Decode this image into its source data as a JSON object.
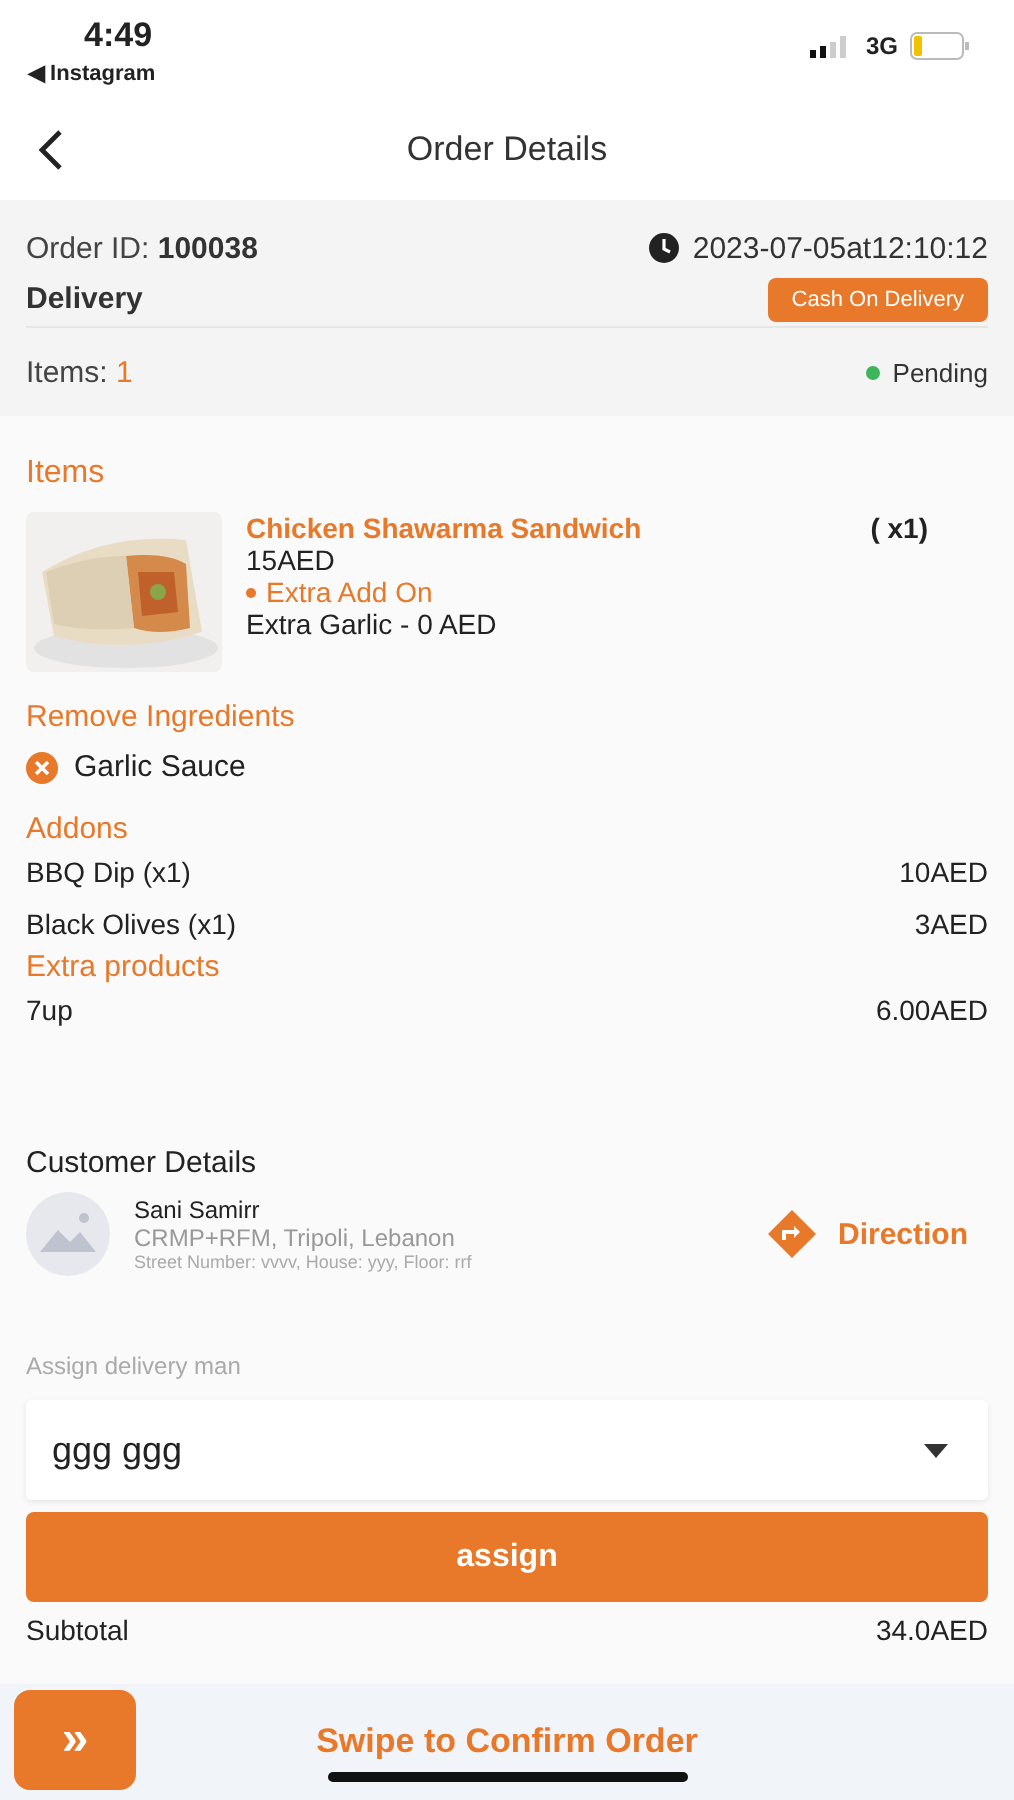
{
  "status_bar": {
    "time": "4:49",
    "back_app": "◀ Instagram",
    "network": "3G"
  },
  "header": {
    "title": "Order Details"
  },
  "order": {
    "id_label": "Order ID:",
    "id": "100038",
    "datetime": "2023-07-05at12:10:12",
    "type": "Delivery",
    "payment": "Cash On Delivery",
    "items_label": "Items:",
    "items_count": "1",
    "status": "Pending"
  },
  "items": {
    "title": "Items",
    "products": [
      {
        "name": "Chicken Shawarma Sandwich",
        "price": "15AED",
        "qty": "( x1)",
        "extra_title": "Extra Add On",
        "extra": "Extra Garlic - 0 AED"
      }
    ],
    "remove_title": "Remove Ingredients",
    "removed": [
      "Garlic Sauce"
    ],
    "addons_title": "Addons",
    "addons": [
      {
        "name": "BBQ Dip (x1)",
        "price": "10AED"
      },
      {
        "name": "Black Olives (x1)",
        "price": "3AED"
      }
    ],
    "extras_title": "Extra products",
    "extras": [
      {
        "name": "7up",
        "price": "6.00AED"
      }
    ]
  },
  "customer": {
    "title": "Customer Details",
    "name": "Sani Samirr",
    "address": "CRMP+RFM, Tripoli, Lebanon",
    "details": "Street Number: vvvv, House: yyy, Floor: rrf",
    "direction": "Direction"
  },
  "assign": {
    "label": "Assign delivery man",
    "value": "ggg ggg",
    "button": "assign"
  },
  "summary": {
    "label": "Subtotal",
    "value": "34.0AED"
  },
  "swipe": {
    "icon": "»",
    "label": "Swipe to Confirm Order"
  }
}
